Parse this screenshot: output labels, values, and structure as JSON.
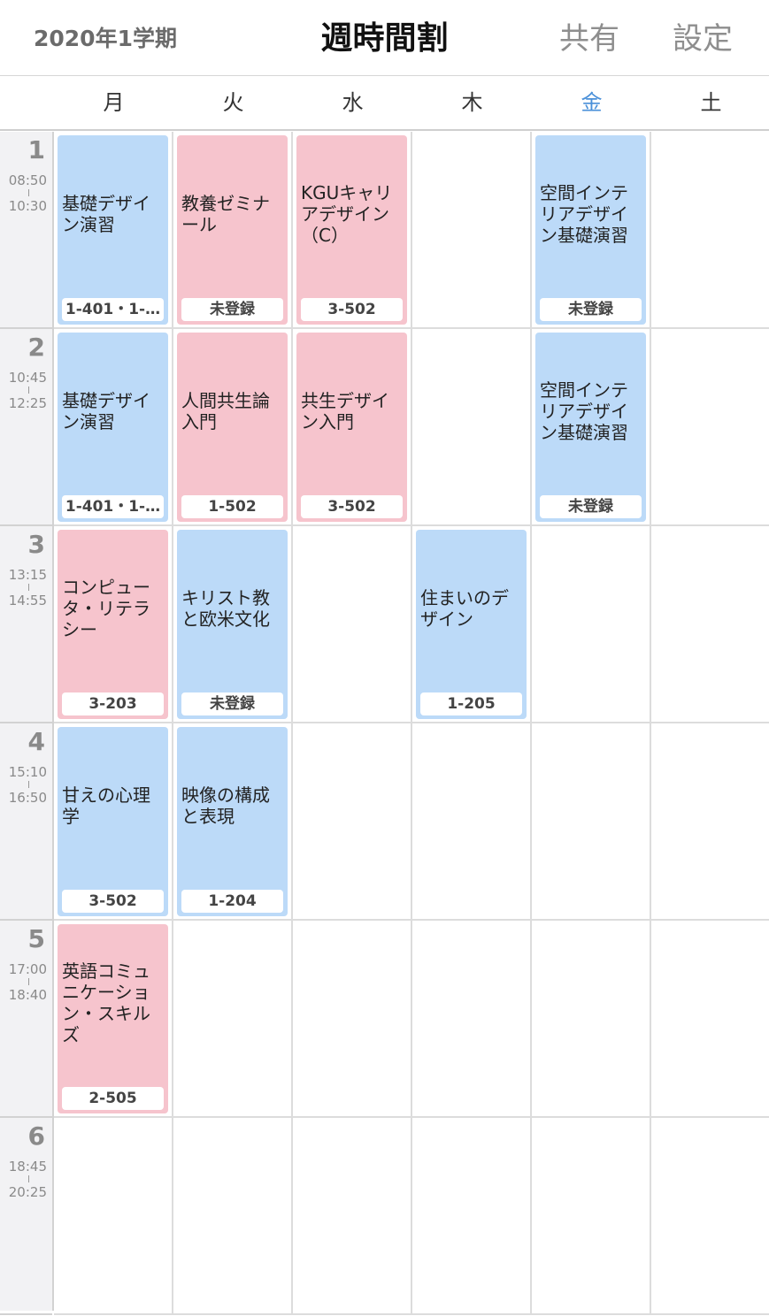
{
  "header": {
    "term": "2020年1学期",
    "title": "週時間割",
    "share_label": "共有",
    "settings_label": "設定"
  },
  "days": [
    "月",
    "火",
    "水",
    "木",
    "金",
    "土"
  ],
  "today_index": 4,
  "periods": [
    {
      "num": "1",
      "start": "08:50",
      "end": "10:30"
    },
    {
      "num": "2",
      "start": "10:45",
      "end": "12:25"
    },
    {
      "num": "3",
      "start": "13:15",
      "end": "14:55"
    },
    {
      "num": "4",
      "start": "15:10",
      "end": "16:50"
    },
    {
      "num": "5",
      "start": "17:00",
      "end": "18:40"
    },
    {
      "num": "6",
      "start": "18:45",
      "end": "20:25"
    }
  ],
  "colors": {
    "blue": "#bcdaf8",
    "pink": "#f6c4cd",
    "today": "#4a90d9"
  },
  "courses": [
    {
      "day": 0,
      "period": 0,
      "name": "基礎デザイン演習",
      "room": "1-401・1-…",
      "color": "blue"
    },
    {
      "day": 1,
      "period": 0,
      "name": "教養ゼミナール",
      "room": "未登録",
      "color": "pink"
    },
    {
      "day": 2,
      "period": 0,
      "name": "KGUキャリアデザイン（C）",
      "room": "3-502",
      "color": "pink"
    },
    {
      "day": 4,
      "period": 0,
      "name": "空間インテリアデザイン基礎演習",
      "room": "未登録",
      "color": "blue"
    },
    {
      "day": 0,
      "period": 1,
      "name": "基礎デザイン演習",
      "room": "1-401・1-…",
      "color": "blue"
    },
    {
      "day": 1,
      "period": 1,
      "name": "人間共生論入門",
      "room": "1-502",
      "color": "pink"
    },
    {
      "day": 2,
      "period": 1,
      "name": "共生デザイン入門",
      "room": "3-502",
      "color": "pink"
    },
    {
      "day": 4,
      "period": 1,
      "name": "空間インテリアデザイン基礎演習",
      "room": "未登録",
      "color": "blue"
    },
    {
      "day": 0,
      "period": 2,
      "name": "コンピュータ・リテラシー",
      "room": "3-203",
      "color": "pink"
    },
    {
      "day": 1,
      "period": 2,
      "name": "キリスト教と欧米文化",
      "room": "未登録",
      "color": "blue"
    },
    {
      "day": 3,
      "period": 2,
      "name": "住まいのデザイン",
      "room": "1-205",
      "color": "blue"
    },
    {
      "day": 0,
      "period": 3,
      "name": "甘えの心理学",
      "room": "3-502",
      "color": "blue"
    },
    {
      "day": 1,
      "period": 3,
      "name": "映像の構成と表現",
      "room": "1-204",
      "color": "blue"
    },
    {
      "day": 0,
      "period": 4,
      "name": "英語コミュニケーション・スキルズ",
      "room": "2-505",
      "color": "pink"
    }
  ]
}
